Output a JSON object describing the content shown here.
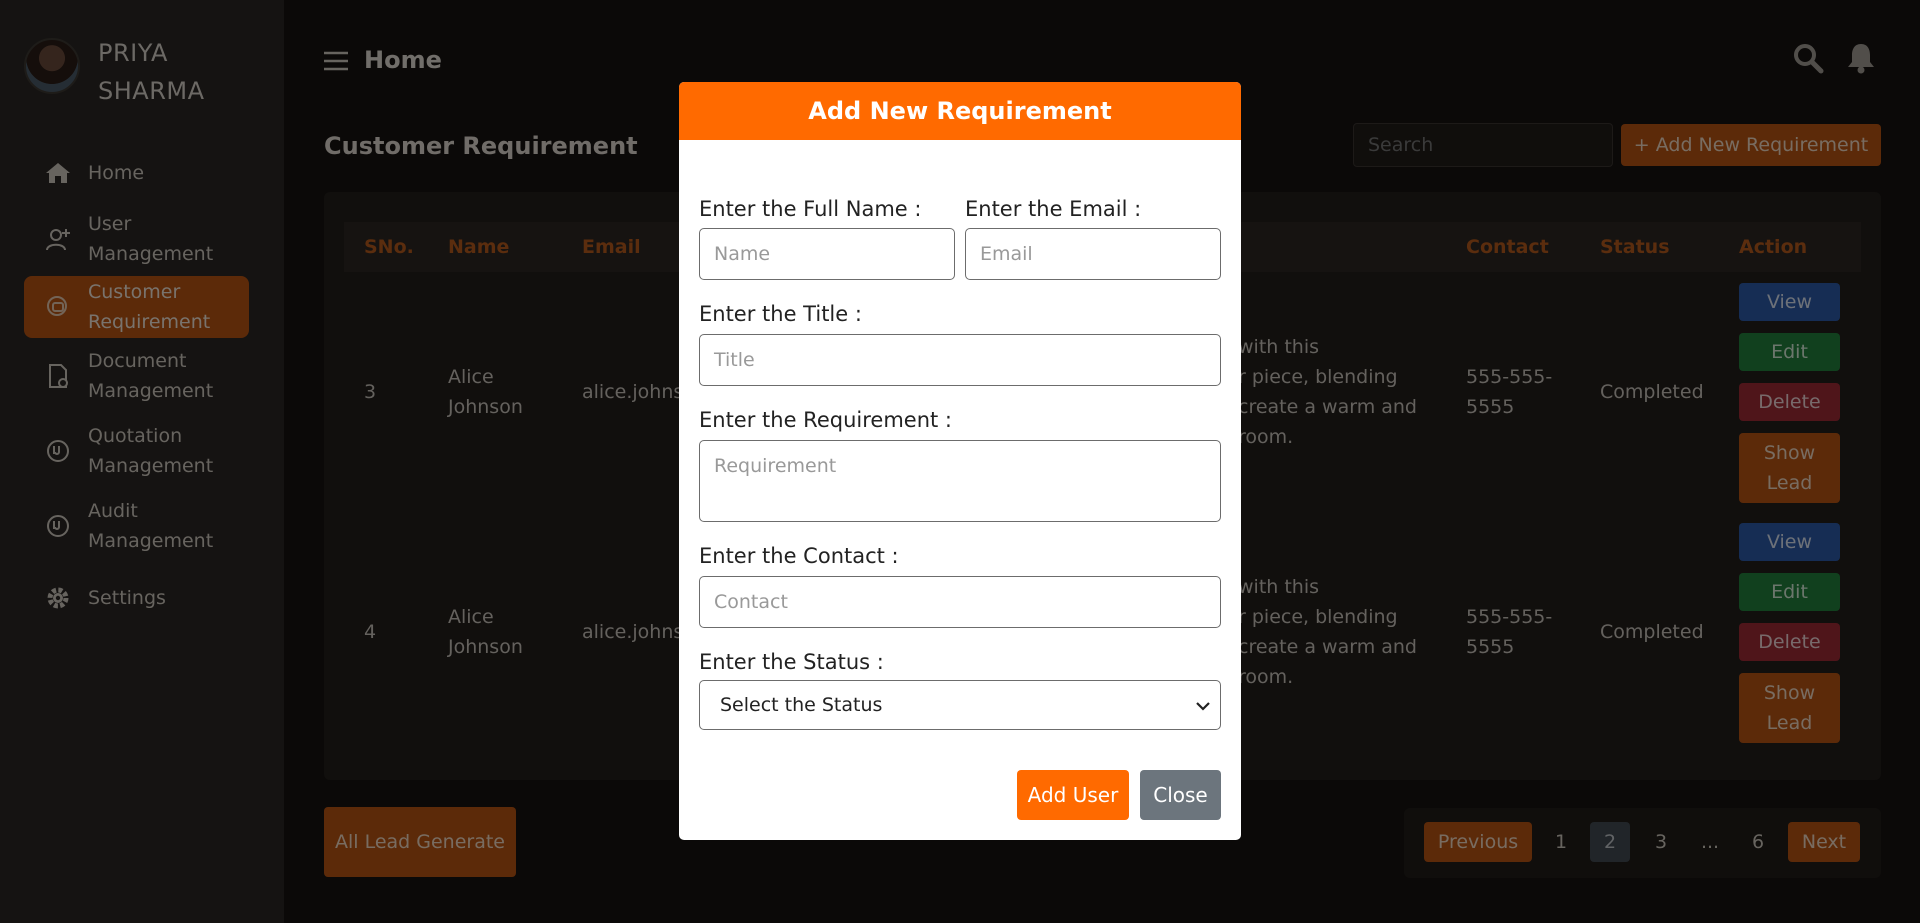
{
  "profile": {
    "name": "PRIYA SHARMA"
  },
  "sidebar": {
    "items": [
      {
        "label": "Home",
        "icon": "home-icon"
      },
      {
        "label": "User Management",
        "icon": "user-add-icon"
      },
      {
        "label": "Customer Requirement",
        "icon": "requirement-icon",
        "active": true
      },
      {
        "label": "Document Management",
        "icon": "document-icon"
      },
      {
        "label": "Quotation Management",
        "icon": "quotation-icon"
      },
      {
        "label": "Audit Management",
        "icon": "audit-icon"
      },
      {
        "label": "Settings",
        "icon": "gear-icon"
      }
    ]
  },
  "header": {
    "title": "Home"
  },
  "page": {
    "title": "Customer Requirement",
    "search_placeholder": "Search",
    "add_button": "+ Add New Requirement"
  },
  "table": {
    "headers": [
      "SNo.",
      "Name",
      "Email",
      "Contact",
      "Status",
      "Action"
    ],
    "rows": [
      {
        "sno": "3",
        "name": "Alice Johnson",
        "email": "alice.johns",
        "req_lines": [
          "with this",
          "r piece, blending",
          "create a warm and",
          "room."
        ],
        "contact": "555-555-5555",
        "status": "Completed"
      },
      {
        "sno": "4",
        "name": "Alice Johnson",
        "email": "alice.johns",
        "req_lines": [
          "with this",
          "r piece, blending",
          "create a warm and",
          "room."
        ],
        "contact": "555-555-5555",
        "status": "Completed"
      }
    ],
    "actions": {
      "view": "View",
      "edit": "Edit",
      "delete": "Delete",
      "show_lead": "Show Lead"
    }
  },
  "footer": {
    "all_lead": "All Lead Generate",
    "pagination": {
      "previous": "Previous",
      "pages": [
        "1",
        "2",
        "3",
        "...",
        "6"
      ],
      "current": "2",
      "next": "Next"
    }
  },
  "modal": {
    "title": "Add New Requirement",
    "name_label": "Enter the Full Name :",
    "name_placeholder": "Name",
    "email_label": "Enter the Email :",
    "email_placeholder": "Email",
    "title_label": "Enter the Title :",
    "title_placeholder": "Title",
    "req_label": "Enter the Requirement :",
    "req_placeholder": "Requirement",
    "contact_label": "Enter the Contact :",
    "contact_placeholder": "Contact",
    "status_label": "Enter the Status :",
    "status_value": "Select the Status",
    "add_button": "Add User",
    "close_button": "Close"
  },
  "colors": {
    "accent": "#ff6a00",
    "accent_dark": "#b95412",
    "view": "#2c5aa8",
    "edit": "#23803c",
    "delete": "#9e2b34"
  }
}
